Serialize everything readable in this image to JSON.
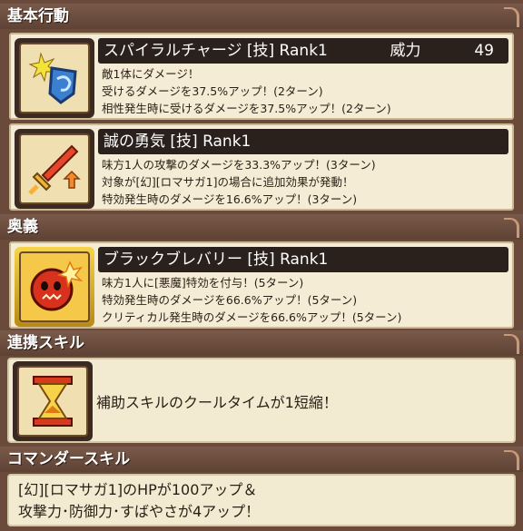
{
  "sections": {
    "basic": "基本行動",
    "ougi": "奥義",
    "renkei": "連携スキル",
    "commander": "コマンダースキル"
  },
  "skills": [
    {
      "title": "スパイラルチャージ [技]  Rank1",
      "power_label": "威力",
      "power_value": "49",
      "lines": [
        "敵1体にダメージ！",
        "受けるダメージを37.5%アップ！(2ターン)",
        "相性発生時に受けるダメージを37.5%アップ！(2ターン)"
      ],
      "icon": "spiral-shield-icon"
    },
    {
      "title": "誠の勇気 [技]  Rank1",
      "lines": [
        "味方1人の攻撃のダメージを33.3%アップ！(3ターン)",
        "対象が[幻][ロマサガ1]の場合に追加効果が発動！",
        "特効発生時のダメージを16.6%アップ！(3ターン)"
      ],
      "icon": "sword-up-icon"
    },
    {
      "title": "ブラックブレバリー [技]  Rank1",
      "lines": [
        "味方1人に[悪魔]特効を付与！(5ターン)",
        "特効発生時のダメージを66.6%アップ！(5ターン)",
        "クリティカル発生時のダメージを66.6%アップ！(5ターン)"
      ],
      "icon": "demon-mask-icon"
    }
  ],
  "renkei": {
    "text": "補助スキルのクールタイムが1短縮！",
    "icon": "hourglass-icon"
  },
  "commander": {
    "line1": "[幻][ロマサガ1]のHPが100アップ＆",
    "line2": "攻撃力･防御力･すばやさが4アップ！"
  }
}
